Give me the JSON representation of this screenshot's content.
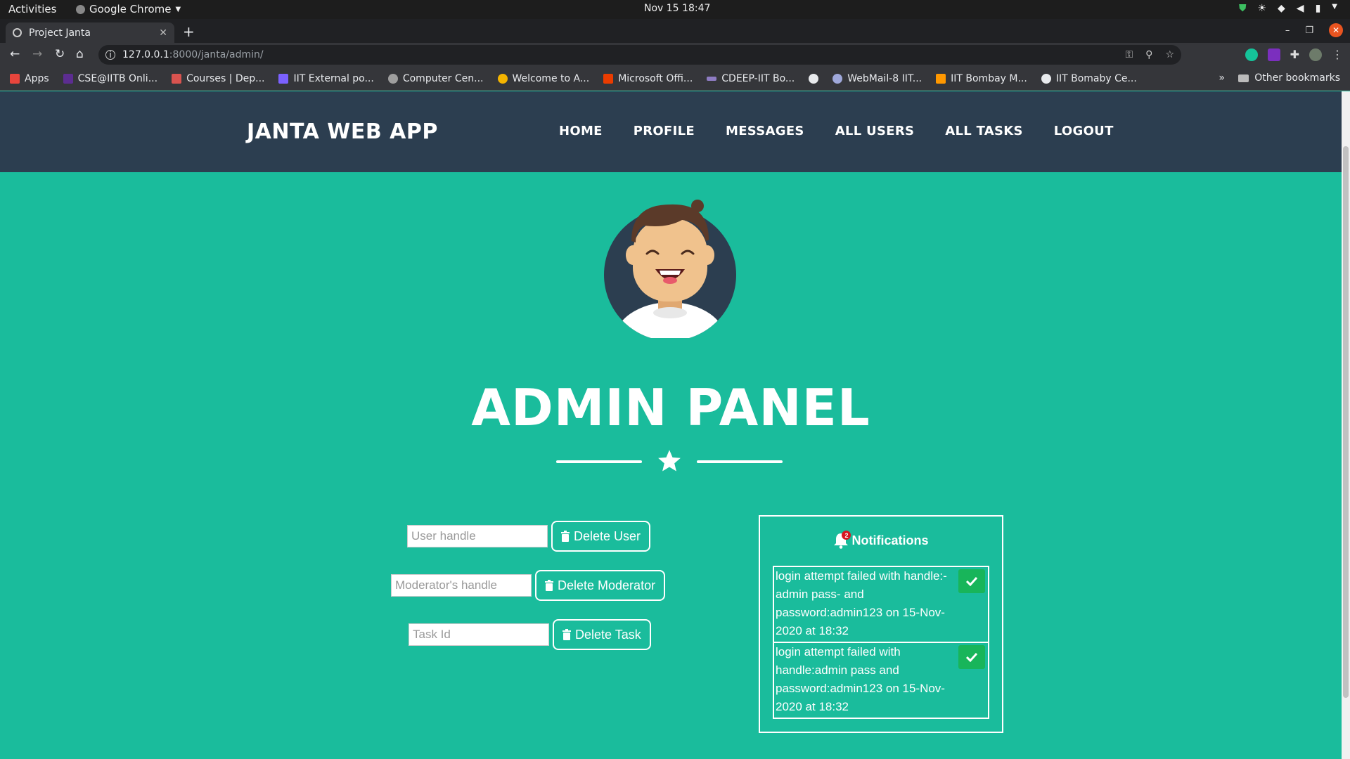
{
  "system_bar": {
    "activities": "Activities",
    "app_name": "Google Chrome",
    "clock": "Nov 15  18:47"
  },
  "browser": {
    "tab_title": "Project Janta",
    "url_host": "127.0.0.1",
    "url_path": ":8000/janta/admin/",
    "bookmarks": [
      {
        "label": "Apps",
        "color": "#e8453c"
      },
      {
        "label": "CSE@IITB Onli...",
        "color": "#5c2d91"
      },
      {
        "label": "Courses | Dep...",
        "color": "#d9534f"
      },
      {
        "label": "IIT External po...",
        "color": "#7b61ff"
      },
      {
        "label": "Computer Cen...",
        "color": "#9e9e9e"
      },
      {
        "label": "Welcome to A...",
        "color": "#f4b400"
      },
      {
        "label": "Microsoft Offi...",
        "color": "#eb3c00"
      },
      {
        "label": "CDEEP-IIT Bo...",
        "color": "#8e7cc3"
      },
      {
        "label": "",
        "color": "#e8eaed"
      },
      {
        "label": "WebMail-8 IIT...",
        "color": "#9fa8da"
      },
      {
        "label": "IIT Bombay M...",
        "color": "#ff9800"
      },
      {
        "label": "IIT Bomaby Ce...",
        "color": "#e8eaed"
      }
    ],
    "more_bookmarks": "»",
    "other_bookmarks": "Other bookmarks"
  },
  "navbar": {
    "brand": "JANTA WEB APP",
    "links": [
      "HOME",
      "PROFILE",
      "MESSAGES",
      "ALL USERS",
      "ALL TASKS",
      "LOGOUT"
    ]
  },
  "hero": {
    "title": "ADMIN PANEL"
  },
  "forms": {
    "user": {
      "placeholder": "User handle",
      "button": "Delete User"
    },
    "moderator": {
      "placeholder": "Moderator's handle",
      "button": "Delete Moderator"
    },
    "task": {
      "placeholder": "Task Id",
      "button": "Delete Task"
    }
  },
  "notifications": {
    "title": "Notifications",
    "count": "2",
    "items": [
      {
        "text": "login attempt failed with handle:-admin pass- and password:admin123 on 15-Nov-2020 at 18:32"
      },
      {
        "text": "login attempt failed with handle:admin pass and password:admin123 on 15-Nov-2020 at 18:32"
      }
    ]
  },
  "colors": {
    "accent": "#1abc9c",
    "navbar": "#2c3e50",
    "check": "#18b55a",
    "badge": "#d9141f"
  }
}
